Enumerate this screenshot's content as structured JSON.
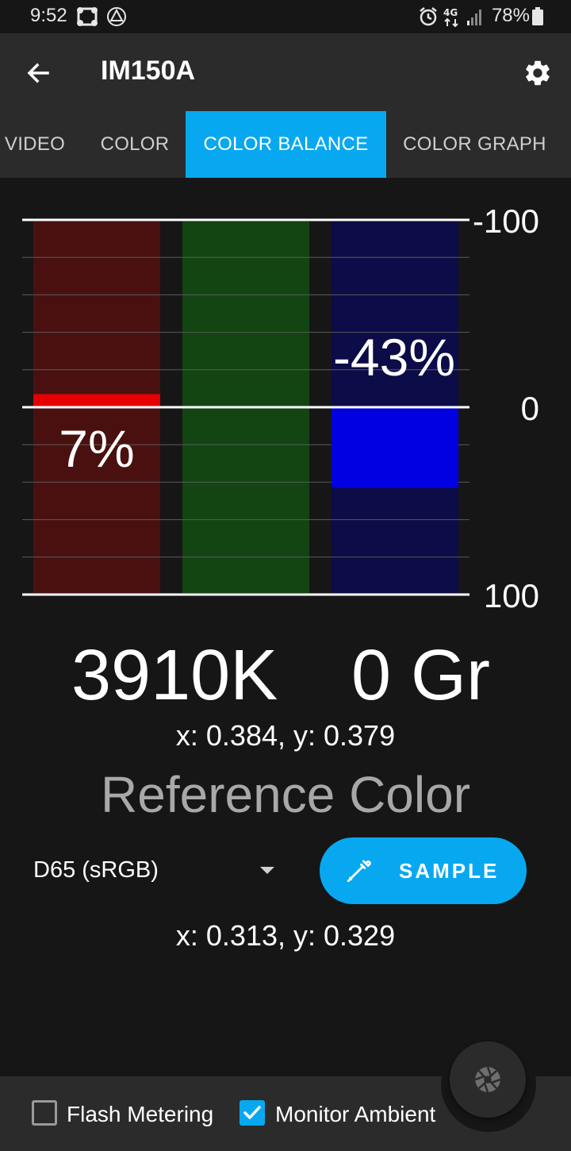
{
  "status": {
    "time": "9:52",
    "battery": "78%",
    "network": "4G"
  },
  "app_bar": {
    "title": "IM150A"
  },
  "tabs": [
    {
      "label": "VIDEO",
      "active": false
    },
    {
      "label": "COLOR",
      "active": false
    },
    {
      "label": "COLOR BALANCE",
      "active": true
    },
    {
      "label": "COLOR GRAPH",
      "active": false
    }
  ],
  "chart_data": {
    "type": "bar",
    "ylim": [
      -100,
      100
    ],
    "tick_labels": [
      "-100",
      "0",
      "100"
    ],
    "categories": [
      "red",
      "green",
      "blue"
    ],
    "values": [
      7,
      0,
      -43
    ],
    "data_labels": [
      "7%",
      "",
      "-43%"
    ],
    "colors": {
      "red_bg": "#4a1010",
      "red_fill": "#e40000",
      "green_bg": "#124512",
      "blue_bg": "#0c0c48",
      "blue_fill": "#0000e0"
    }
  },
  "readouts": {
    "cct": "3910K",
    "tint": "0 Gr",
    "measured_xy": "x: 0.384, y: 0.379"
  },
  "reference": {
    "title": "Reference Color",
    "selected": "D65 (sRGB)",
    "sample_label": "SAMPLE",
    "xy": "x: 0.313, y: 0.329"
  },
  "bottom": {
    "flash_metering": {
      "label": "Flash Metering",
      "checked": false
    },
    "monitor_ambient": {
      "label": "Monitor Ambient",
      "checked": true
    }
  },
  "colors": {
    "accent": "#08a8f0",
    "bar_bg": "#2b2b2b",
    "page_bg": "#161616"
  }
}
